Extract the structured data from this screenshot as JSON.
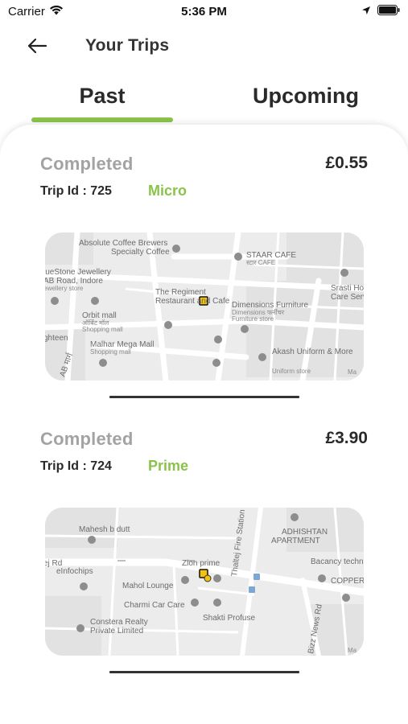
{
  "status_bar": {
    "carrier": "Carrier",
    "time": "5:36 PM"
  },
  "header": {
    "title": "Your Trips"
  },
  "tabs": [
    {
      "label": "Past",
      "active": true
    },
    {
      "label": "Upcoming",
      "active": false
    }
  ],
  "colors": {
    "accent": "#8bc34a",
    "muted": "#a3a3a3"
  },
  "trips": [
    {
      "status": "Completed",
      "price": "£0.55",
      "trip_id": "Trip Id : 725",
      "type": "Micro",
      "map_labels": {
        "l1": "Absolute Coffee Brewers",
        "l2": "Specialty Coffee",
        "l3": "STAAR CAFE",
        "l4": "स्टार CAFE",
        "l5": "lueStone Jewellery",
        "l6": "AB Road, Indore",
        "l7": "ewellery store",
        "l8": "Srasti Ho",
        "l9": "Care Serv",
        "l10": "The Regiment",
        "l11": "Restaurant and Cafe",
        "l12": "Dimensions Furniture",
        "l13": "Dimensions फर्नीचर",
        "l14": "Furniture store",
        "l15": "Orbit mall",
        "l16": "ऑर्बिट मॉल",
        "l17": "Shopping mall",
        "l18": "ghteen",
        "l19": "Malhar Mega Mall",
        "l20": "Shopping mall",
        "l21": "Akash Uniform & More",
        "l22": "Uniform store",
        "l23": "AB मार्ग",
        "l24": "Ma"
      }
    },
    {
      "status": "Completed",
      "price": "£3.90",
      "trip_id": "Trip Id : 724",
      "type": "Prime",
      "map_labels": {
        "l1": "Mahesh b dutt",
        "l2": "Thaltej Fire Station R",
        "l3": "ADHISHTAN",
        "l4": "APARTMENT",
        "l5": "ej Rd",
        "l6": "eInfochips",
        "l7": "Zion prime",
        "l8": "Bacancy techno",
        "l9": "COPPER",
        "l10": "Mahol Lounge",
        "l11": "Charmi Car Care",
        "l12": "Shakti Profuse",
        "l13": "Constera Realty",
        "l14": "Private Limited",
        "l15": "Bizz News Rd",
        "l16": "Ma"
      }
    }
  ]
}
